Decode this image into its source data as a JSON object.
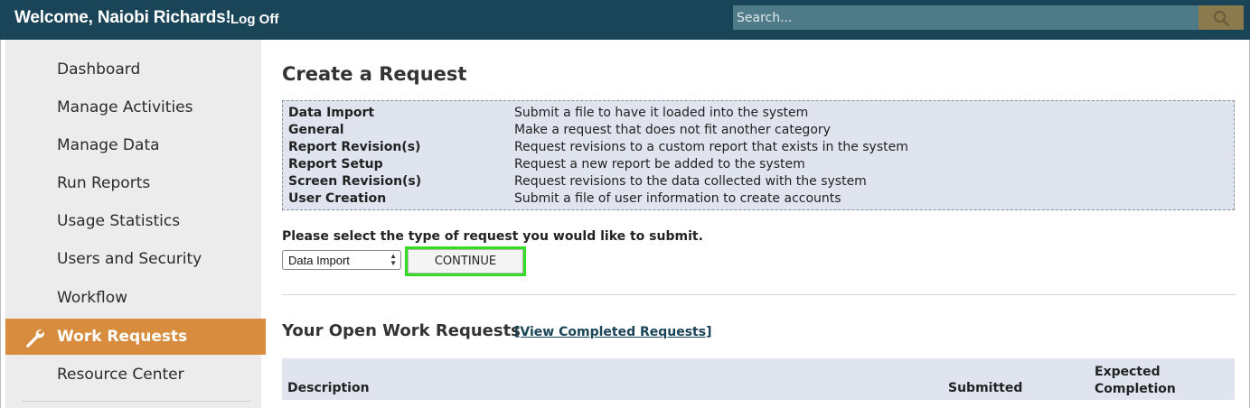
{
  "header": {
    "welcome": "Welcome, Naiobi Richards!",
    "logoff": "Log Off",
    "search_placeholder": "Search..."
  },
  "sidebar": {
    "items": [
      {
        "label": "Dashboard",
        "active": false
      },
      {
        "label": "Manage Activities",
        "active": false
      },
      {
        "label": "Manage Data",
        "active": false
      },
      {
        "label": "Run Reports",
        "active": false
      },
      {
        "label": "Usage Statistics",
        "active": false
      },
      {
        "label": "Users and Security",
        "active": false
      },
      {
        "label": "Workflow",
        "active": false
      },
      {
        "label": "Work Requests",
        "active": true,
        "icon": "wrench-icon"
      },
      {
        "label": "Resource Center",
        "active": false
      }
    ]
  },
  "main": {
    "title": "Create a Request",
    "request_types": [
      {
        "name": "Data Import",
        "description": "Submit a file to have it loaded into the system"
      },
      {
        "name": "General",
        "description": "Make a request that does not fit another category"
      },
      {
        "name": "Report Revision(s)",
        "description": "Request revisions to a custom report that exists in the system"
      },
      {
        "name": "Report Setup",
        "description": "Request a new report be added to the system"
      },
      {
        "name": "Screen Revision(s)",
        "description": "Request revisions to the data collected with the system"
      },
      {
        "name": "User Creation",
        "description": "Submit a file of user information to create accounts"
      }
    ],
    "prompt": "Please select the type of request you would like to submit.",
    "select_value": "Data Import",
    "continue_label": "CONTINUE",
    "open_requests_title": "Your Open Work Requests",
    "view_completed_label": "[View Completed Requests]",
    "table_headers": {
      "description": "Description",
      "submitted": "Submitted",
      "expected_completion": "Expected Completion"
    }
  },
  "colors": {
    "topbar": "#1a4457",
    "search_bg": "#4f7a87",
    "search_button": "#8c7a4f",
    "active_nav": "#d78c3e",
    "highlight": "#33dd22",
    "panel_bg": "#dfe4ee"
  }
}
